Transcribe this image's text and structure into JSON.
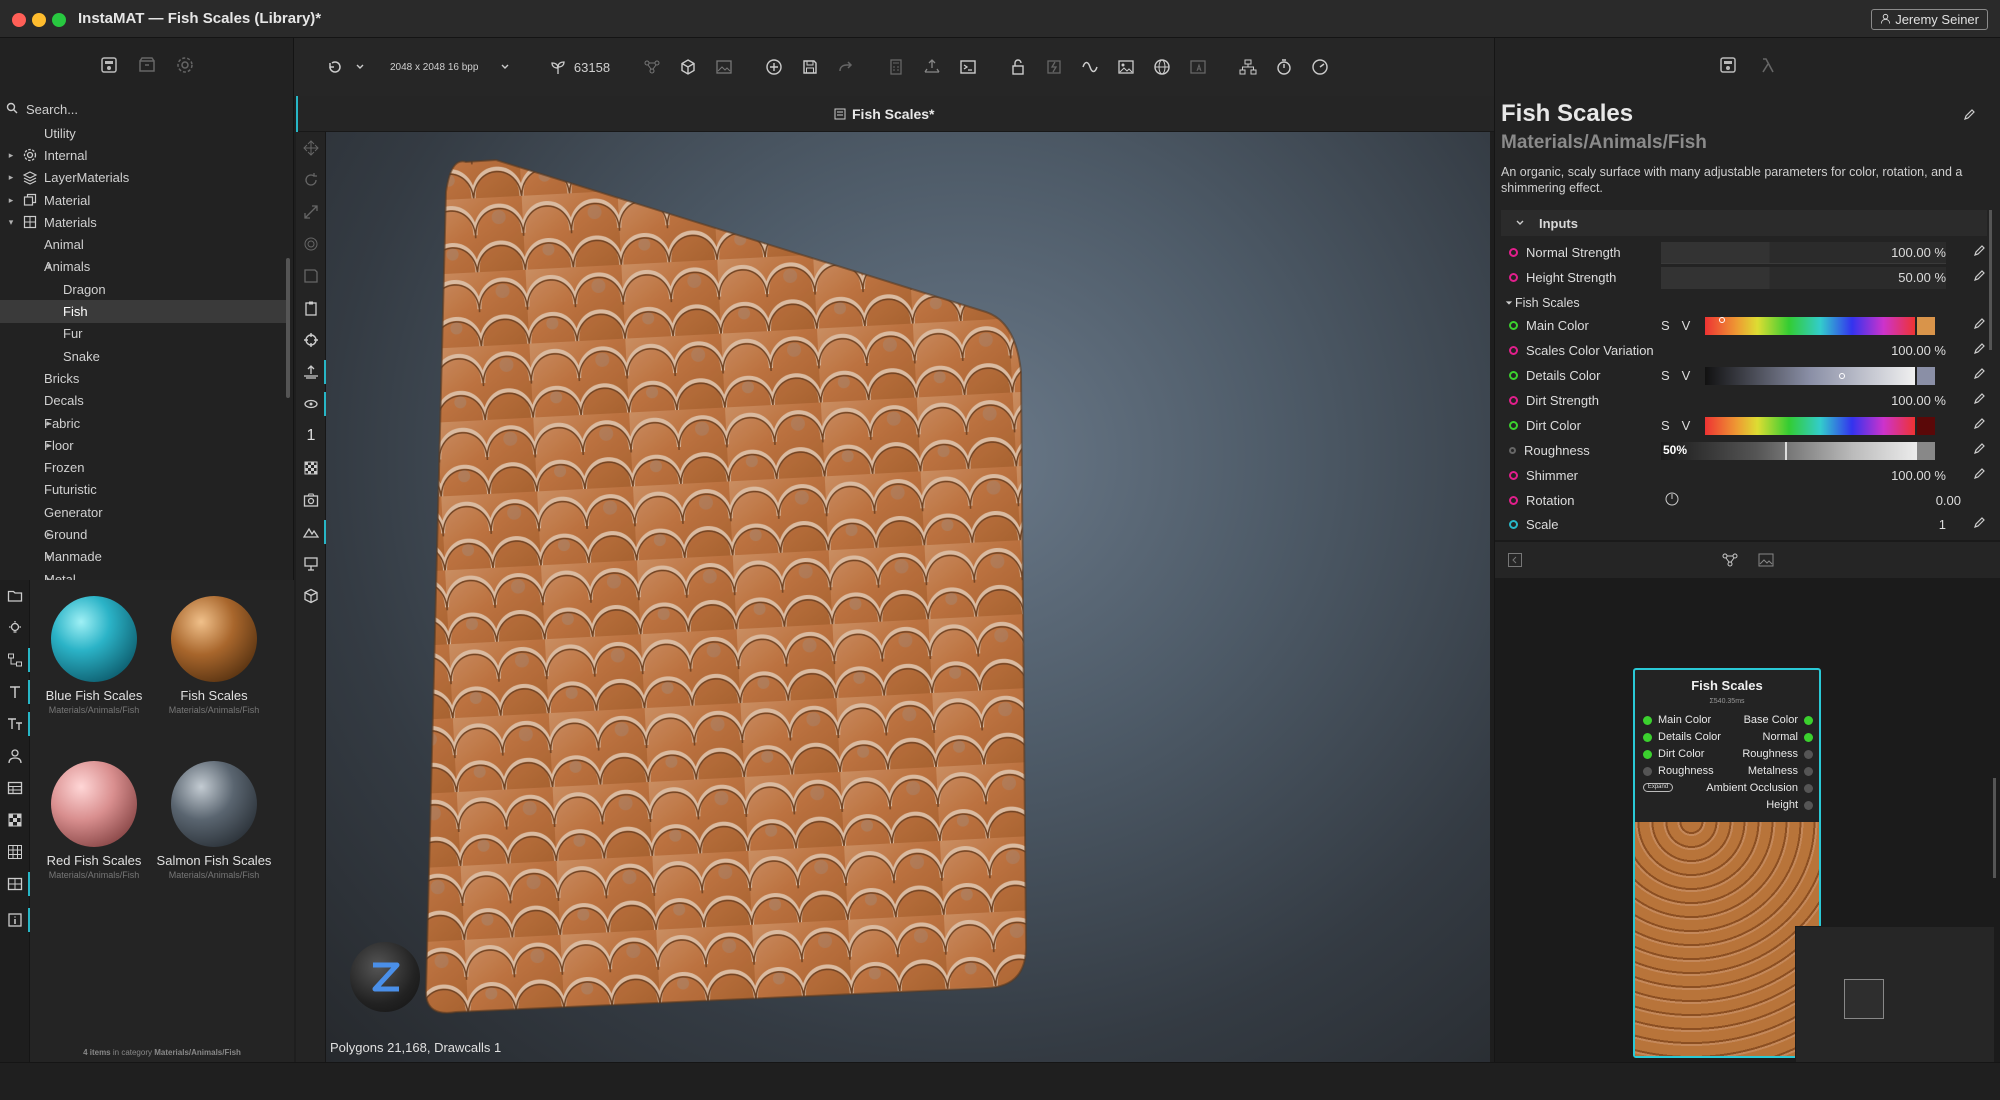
{
  "window": {
    "title": "InstaMAT — Fish Scales (Library)*",
    "user": "Jeremy Seiner"
  },
  "search": {
    "placeholder": "Search..."
  },
  "tree": [
    {
      "label": "Utility",
      "indent": 0,
      "arrow": "",
      "icon": ""
    },
    {
      "label": "Internal",
      "indent": 0,
      "arrow": "right",
      "icon": "gear-icon"
    },
    {
      "label": "LayerMaterials",
      "indent": 0,
      "arrow": "right",
      "icon": "layers-icon"
    },
    {
      "label": "Material",
      "indent": 0,
      "arrow": "right",
      "icon": "copy-icon"
    },
    {
      "label": "Materials",
      "indent": 0,
      "arrow": "down",
      "icon": "grid-icon"
    },
    {
      "label": "Animal",
      "indent": 1,
      "arrow": "",
      "icon": ""
    },
    {
      "label": "Animals",
      "indent": 1,
      "arrow": "down",
      "icon": ""
    },
    {
      "label": "Dragon",
      "indent": 2,
      "arrow": "",
      "icon": ""
    },
    {
      "label": "Fish",
      "indent": 2,
      "arrow": "",
      "icon": "",
      "selected": true
    },
    {
      "label": "Fur",
      "indent": 2,
      "arrow": "",
      "icon": ""
    },
    {
      "label": "Snake",
      "indent": 2,
      "arrow": "",
      "icon": ""
    },
    {
      "label": "Bricks",
      "indent": 1,
      "arrow": "",
      "icon": ""
    },
    {
      "label": "Decals",
      "indent": 1,
      "arrow": "",
      "icon": ""
    },
    {
      "label": "Fabric",
      "indent": 1,
      "arrow": "right",
      "icon": ""
    },
    {
      "label": "Floor",
      "indent": 1,
      "arrow": "right",
      "icon": ""
    },
    {
      "label": "Frozen",
      "indent": 1,
      "arrow": "",
      "icon": ""
    },
    {
      "label": "Futuristic",
      "indent": 1,
      "arrow": "",
      "icon": ""
    },
    {
      "label": "Generator",
      "indent": 1,
      "arrow": "",
      "icon": ""
    },
    {
      "label": "Ground",
      "indent": 1,
      "arrow": "right",
      "icon": ""
    },
    {
      "label": "Manmade",
      "indent": 1,
      "arrow": "right",
      "icon": ""
    },
    {
      "label": "Metal",
      "indent": 1,
      "arrow": "right",
      "icon": ""
    }
  ],
  "gallery": {
    "items": [
      {
        "name": "Blue Fish Scales",
        "path": "Materials/Animals/Fish",
        "color": "#2bb3c7"
      },
      {
        "name": "Fish Scales",
        "path": "Materials/Animals/Fish",
        "color": "#a8662c"
      },
      {
        "name": "Red Fish Scales",
        "path": "Materials/Animals/Fish",
        "color": "#d98f8f"
      },
      {
        "name": "Salmon Fish Scales",
        "path": "Materials/Animals/Fish",
        "color": "#5a6570"
      }
    ],
    "footer_count": "4 items",
    "footer_text": " in category ",
    "footer_category": "Materials/Animals/Fish"
  },
  "toolbar": {
    "resolution": "2048 x 2048 16 bpp",
    "seed": "63158"
  },
  "viewport": {
    "tab_label": "Fish Scales*",
    "status": "Polygons 21,168, Drawcalls 1",
    "side_number": "1"
  },
  "inspector": {
    "title": "Fish Scales",
    "subtitle": "Materials/Animals/Fish",
    "description": "An organic, scaly surface with many adjustable parameters for color, rotation, and a shimmering effect.",
    "inputs_label": "Inputs",
    "group_label": "Fish Scales",
    "params": {
      "normal_strength": {
        "label": "Normal Strength",
        "value": "100.00 %"
      },
      "height_strength": {
        "label": "Height Strength",
        "value": "50.00 %"
      },
      "main_color": {
        "label": "Main Color",
        "s": "S",
        "v": "V",
        "swatch": "#d9944a"
      },
      "scales_color_variation": {
        "label": "Scales Color Variation",
        "value": "100.00 %"
      },
      "details_color": {
        "label": "Details Color",
        "s": "S",
        "v": "V",
        "swatch": "#8a8fa6"
      },
      "dirt_strength": {
        "label": "Dirt Strength",
        "value": "100.00 %"
      },
      "dirt_color": {
        "label": "Dirt Color",
        "s": "S",
        "v": "V",
        "swatch": "#5a0808"
      },
      "roughness": {
        "label": "Roughness",
        "value": "50%"
      },
      "shimmer": {
        "label": "Shimmer",
        "value": "100.00 %"
      },
      "rotation": {
        "label": "Rotation",
        "value": "0.00"
      },
      "scale": {
        "label": "Scale",
        "value": "1"
      }
    }
  },
  "node": {
    "title": "Fish Scales",
    "time": "Σ540.35ms",
    "inputs": [
      "Main Color",
      "Details Color",
      "Dirt Color",
      "Roughness"
    ],
    "outputs": [
      "Base Color",
      "Normal",
      "Roughness",
      "Metalness",
      "Ambient Occlusion",
      "Height"
    ],
    "expand_label": "Expand"
  },
  "colors": {
    "accent": "#27b6c6",
    "param_dot": "#e21f8c",
    "connected_dot": "#3bd12e"
  }
}
